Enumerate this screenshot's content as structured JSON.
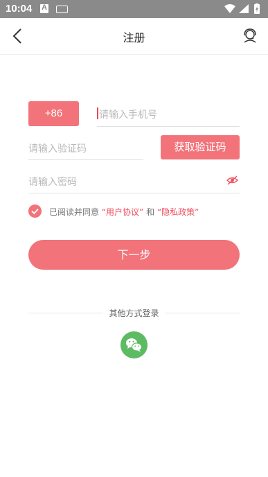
{
  "status_bar": {
    "time": "10:04"
  },
  "header": {
    "title": "注册"
  },
  "form": {
    "country_code": "+86",
    "phone_placeholder": "请输入手机号",
    "verify_placeholder": "请输入验证码",
    "get_code_label": "获取验证码",
    "password_placeholder": "请输入密码"
  },
  "agreement": {
    "checked": true,
    "prefix": "已阅读并同意",
    "user_agreement": "“用户协议”",
    "and": "和",
    "privacy_policy": "“隐私政策”"
  },
  "next_button": "下一步",
  "other_login": {
    "label": "其他方式登录",
    "icons": [
      "wechat-icon"
    ]
  },
  "colors": {
    "accent": "#f2737a",
    "link": "#ef4f5f",
    "wechat": "#5dbb63"
  }
}
